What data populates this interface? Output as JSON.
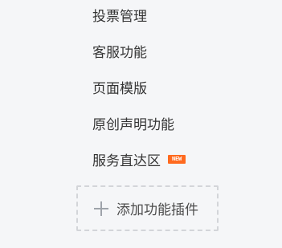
{
  "menu": {
    "items": [
      {
        "label": "投票管理"
      },
      {
        "label": "客服功能"
      },
      {
        "label": "页面模版"
      },
      {
        "label": "原创声明功能"
      },
      {
        "label": "服务直达区",
        "badge": "NEW"
      }
    ]
  },
  "add_plugin": {
    "label": "添加功能插件",
    "icon": "plus-icon"
  },
  "colors": {
    "background": "#f5f6f8",
    "text": "#353535",
    "badge": "#ff6a1f",
    "dashed_border": "#d3d5d9"
  }
}
